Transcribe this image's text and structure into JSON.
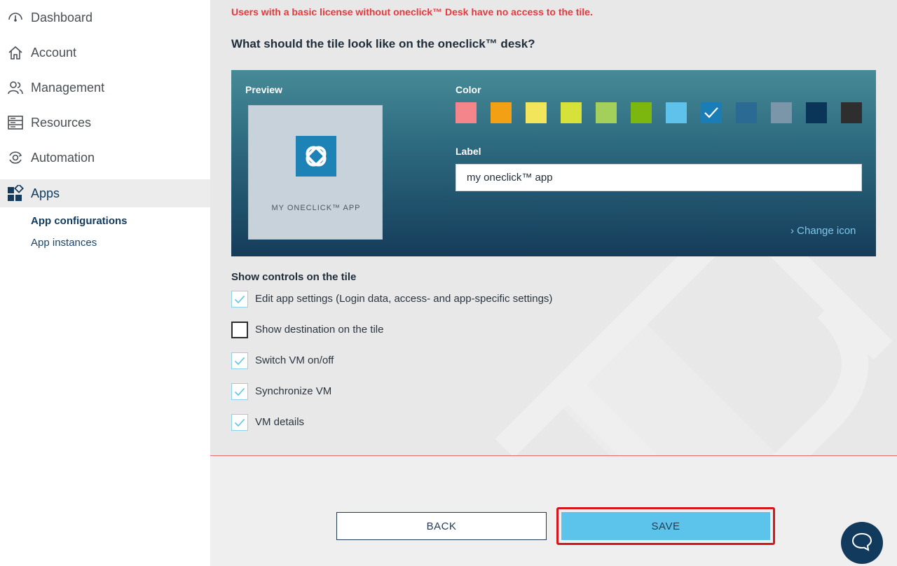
{
  "sidebar": {
    "items": [
      {
        "label": "Dashboard",
        "icon": "dashboard-icon"
      },
      {
        "label": "Account",
        "icon": "home-icon"
      },
      {
        "label": "Management",
        "icon": "users-icon"
      },
      {
        "label": "Resources",
        "icon": "server-icon"
      },
      {
        "label": "Automation",
        "icon": "gear-cycle-icon"
      },
      {
        "label": "Apps",
        "icon": "apps-icon"
      }
    ],
    "sub_items": [
      {
        "label": "App configurations",
        "active": true
      },
      {
        "label": "App instances",
        "active": false
      }
    ]
  },
  "main": {
    "warning": "Users with a basic license without oneclick™ Desk have no access to the tile.",
    "question": "What should the tile look like on the oneclick™ desk?",
    "panel": {
      "preview_title": "Preview",
      "tile_label": "MY ONECLICK™ APP",
      "color_title": "Color",
      "colors": [
        "#f4858b",
        "#f4a015",
        "#f2e55c",
        "#d6e13a",
        "#a2d05a",
        "#7cb70f",
        "#5ec2ea",
        "#1b7db6",
        "#2b6a92",
        "#7a96a8",
        "#0b3558",
        "#2e2e2e"
      ],
      "selected_color": "#1b7db6",
      "label_title": "Label",
      "label_value": "my oneclick™ app",
      "change_icon": "Change icon"
    },
    "controls": {
      "title": "Show controls on the tile",
      "items": [
        {
          "label": "Edit app settings (Login data, access- and app-specific settings)",
          "checked": true
        },
        {
          "label": "Show destination on the tile",
          "checked": false
        },
        {
          "label": "Switch VM on/off",
          "checked": true
        },
        {
          "label": "Synchronize VM",
          "checked": true
        },
        {
          "label": "VM details",
          "checked": true
        }
      ]
    },
    "buttons": {
      "back": "BACK",
      "save": "SAVE"
    }
  }
}
